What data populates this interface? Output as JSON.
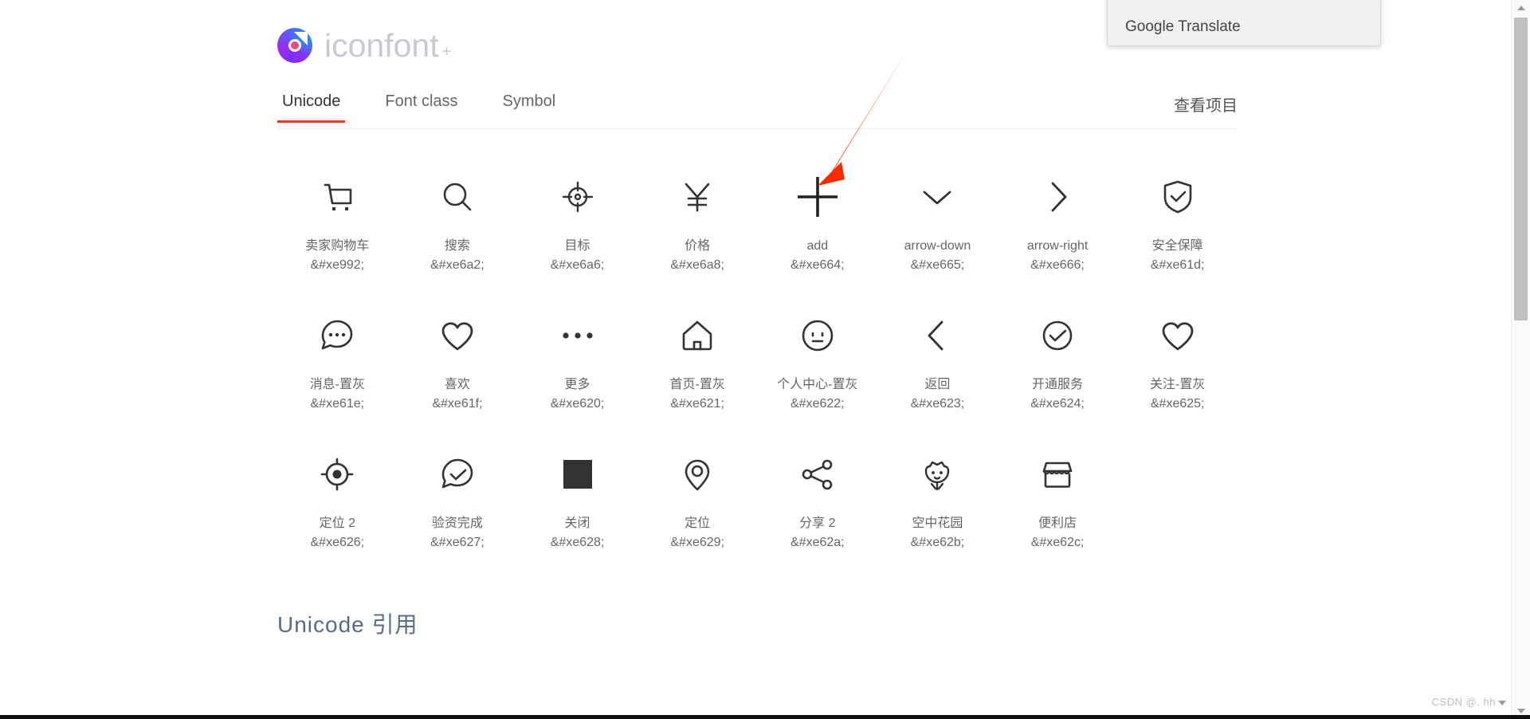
{
  "site": {
    "logo_text": "iconfont",
    "logo_plus": "+",
    "logo_icon": "iconfont-logo-icon"
  },
  "tabs": [
    {
      "label": "Unicode",
      "active": true
    },
    {
      "label": "Font class",
      "active": false
    },
    {
      "label": "Symbol",
      "active": false
    }
  ],
  "header_link": {
    "label": "查看项目"
  },
  "icons": [
    {
      "name": "卖家购物车",
      "code": "&#xe992;",
      "glyph": "shopping-cart-icon"
    },
    {
      "name": "搜索",
      "code": "&#xe6a2;",
      "glyph": "search-icon"
    },
    {
      "name": "目标",
      "code": "&#xe6a6;",
      "glyph": "target-icon"
    },
    {
      "name": "价格",
      "code": "&#xe6a8;",
      "glyph": "yen-price-icon"
    },
    {
      "name": "add",
      "code": "&#xe664;",
      "glyph": "plus-icon"
    },
    {
      "name": "arrow-down",
      "code": "&#xe665;",
      "glyph": "chevron-down-icon"
    },
    {
      "name": "arrow-right",
      "code": "&#xe666;",
      "glyph": "chevron-right-icon"
    },
    {
      "name": "安全保障",
      "code": "&#xe61d;",
      "glyph": "shield-check-icon"
    },
    {
      "name": "消息-置灰",
      "code": "&#xe61e;",
      "glyph": "message-bubble-icon"
    },
    {
      "name": "喜欢",
      "code": "&#xe61f;",
      "glyph": "heart-icon"
    },
    {
      "name": "更多",
      "code": "&#xe620;",
      "glyph": "more-dots-icon"
    },
    {
      "name": "首页-置灰",
      "code": "&#xe621;",
      "glyph": "home-icon"
    },
    {
      "name": "个人中心-置灰",
      "code": "&#xe622;",
      "glyph": "user-face-icon"
    },
    {
      "name": "返回",
      "code": "&#xe623;",
      "glyph": "chevron-left-icon"
    },
    {
      "name": "开通服务",
      "code": "&#xe624;",
      "glyph": "circle-check-icon"
    },
    {
      "name": "关注-置灰",
      "code": "&#xe625;",
      "glyph": "heart-outline-icon"
    },
    {
      "name": "定位 2",
      "code": "&#xe626;",
      "glyph": "crosshair-dot-icon"
    },
    {
      "name": "验资完成",
      "code": "&#xe627;",
      "glyph": "bubble-check-icon"
    },
    {
      "name": "关闭",
      "code": "&#xe628;",
      "glyph": "filled-square-icon"
    },
    {
      "name": "定位",
      "code": "&#xe629;",
      "glyph": "location-pin-icon"
    },
    {
      "name": "分享 2",
      "code": "&#xe62a;",
      "glyph": "share-nodes-icon"
    },
    {
      "name": "空中花园",
      "code": "&#xe62b;",
      "glyph": "flower-face-icon"
    },
    {
      "name": "便利店",
      "code": "&#xe62c;",
      "glyph": "storefront-icon"
    }
  ],
  "section_title": "Unicode 引用",
  "translate_popup": {
    "title": "Google Translate"
  },
  "watermark": {
    "text": "CSDN @. hh"
  },
  "colors": {
    "accent_red": "#e8391d",
    "annotation_red": "#f72c00",
    "logo_gray": "#c9c9d4",
    "label_gray": "#666666",
    "section_blue": "#5a6b86",
    "progress_blue": "#1a73e8"
  }
}
